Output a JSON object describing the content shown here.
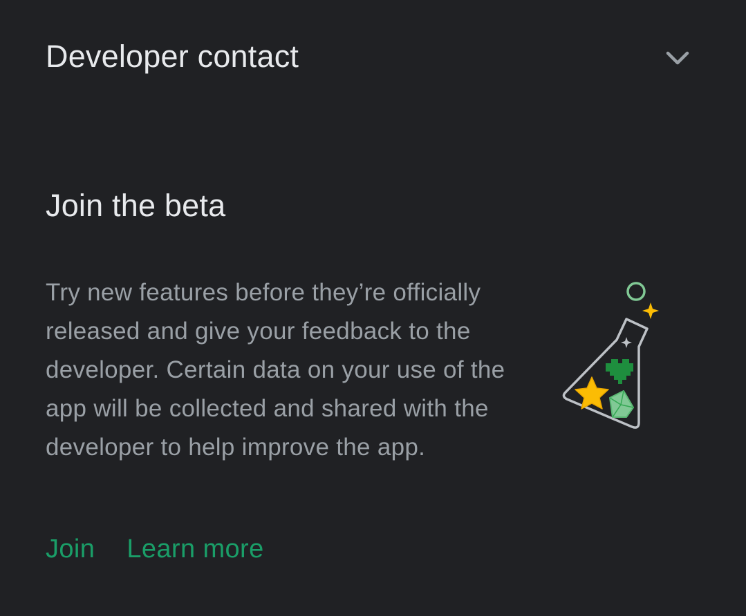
{
  "developer_contact": {
    "title": "Developer contact",
    "expand_icon": "chevron-down-icon"
  },
  "beta": {
    "title": "Join the beta",
    "description": "Try new features before they’re officially released and give your feedback to the developer. Certain data on your use of the app will be collected and shared with the developer to help improve the app.",
    "illustration": "beta-flask-icon",
    "actions": {
      "join_label": "Join",
      "learn_more_label": "Learn more"
    }
  },
  "colors": {
    "background": "#202124",
    "title_text": "#e8eaed",
    "body_text": "#9aa0a6",
    "accent": "#1a9e68",
    "flask_outline": "#bdc1c6",
    "heart": "#1e8e3e",
    "star": "#fbbc04",
    "gem": "#81c995"
  }
}
